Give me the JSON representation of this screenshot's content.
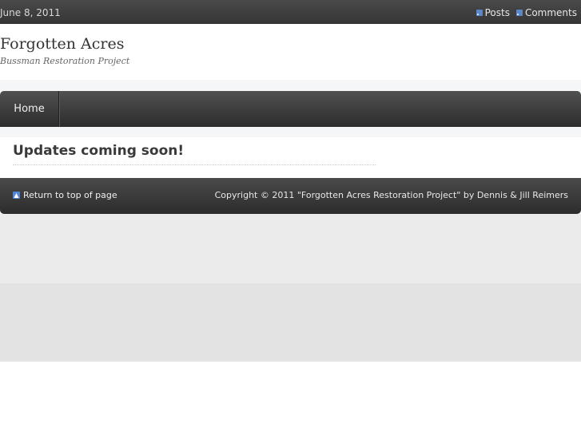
{
  "topbar": {
    "date": "June 8, 2011",
    "feeds": [
      {
        "label": "Posts",
        "icon": "rss-icon"
      },
      {
        "label": "Comments",
        "icon": "rss-icon"
      }
    ]
  },
  "header": {
    "title": "Forgotten Acres",
    "description": "Bussman Restoration Project"
  },
  "nav": {
    "items": [
      {
        "label": "Home"
      }
    ]
  },
  "post": {
    "title": "Updates coming soon!"
  },
  "footer": {
    "back_to_top": "Return to top of page",
    "back_to_top_icon": "arrow-up-icon",
    "copyright": "Copyright © 2011 \"Forgotten Acres Restoration Project\" by Dennis & Jill Reimers"
  },
  "colors": {
    "bar_dark": "#353535",
    "accent_blue": "#4f86d9"
  }
}
